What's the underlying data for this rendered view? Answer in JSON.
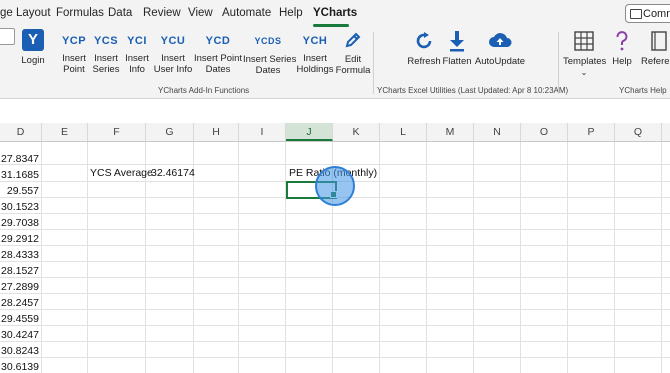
{
  "menubar": {
    "items": [
      "ge Layout",
      "Formulas",
      "Data",
      "Review",
      "View",
      "Automate",
      "Help",
      "YCharts"
    ],
    "active": "YCharts",
    "comments_label": "Comme"
  },
  "ribbon": {
    "login": {
      "label": "Login"
    },
    "buttons": [
      {
        "code": "YCP",
        "label1": "Insert",
        "label2": "Point"
      },
      {
        "code": "YCS",
        "label1": "Insert",
        "label2": "Series"
      },
      {
        "code": "YCI",
        "label1": "Insert",
        "label2": "Info"
      },
      {
        "code": "YCU",
        "label1": "Insert",
        "label2": "User Info"
      },
      {
        "code": "YCD",
        "label1": "Insert Point",
        "label2": "Dates"
      },
      {
        "code": "YCDS",
        "label1": "Insert Series",
        "label2": "Dates"
      },
      {
        "code": "YCH",
        "label1": "Insert",
        "label2": "Holdings"
      },
      {
        "code": "",
        "label1": "Edit",
        "label2": "Formula"
      }
    ],
    "utilities": [
      {
        "label": "Refresh",
        "icon": "refresh-icon"
      },
      {
        "label": "Flatten",
        "icon": "download-arrow-icon"
      },
      {
        "label": "AutoUpdate",
        "icon": "cloud-upload-icon"
      }
    ],
    "help": [
      {
        "label": "Templates",
        "icon": "table-grid-icon"
      },
      {
        "label": "Help",
        "icon": "question-icon"
      },
      {
        "label": "Referen",
        "icon": "book-icon"
      }
    ],
    "groups": {
      "functions": "YCharts Add-In Functions",
      "utilities": "YCharts Excel Utilities (Last Updated: Apr 8 10:23AM)",
      "help": "YCharts Help"
    },
    "colors": {
      "brand_blue": "#1a5fb4",
      "excel_green": "#1a7a3c"
    }
  },
  "sheet": {
    "columns": [
      "D",
      "E",
      "F",
      "G",
      "H",
      "I",
      "J",
      "K",
      "L",
      "M",
      "N",
      "O",
      "P",
      "Q"
    ],
    "selected_column": "J",
    "ycs_label": "YCS Average",
    "ycs_value": "32.46174",
    "pe_label": "PE Ratio (monthly)",
    "d_values": [
      "27.8347",
      "31.1685",
      "29.557",
      "30.1523",
      "29.7038",
      "29.2912",
      "28.4333",
      "28.1527",
      "27.2899",
      "28.2457",
      "29.4559",
      "30.4247",
      "30.8243",
      "30.6139"
    ]
  }
}
